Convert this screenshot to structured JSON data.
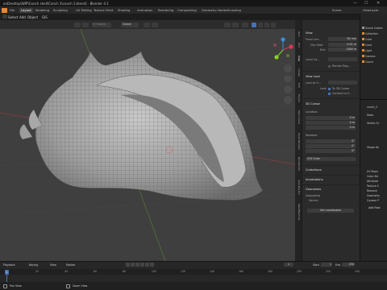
{
  "window": {
    "title": "onDesktop\\WIP\\Conch shell\\Conch 3\\conch 3.blend] - Blender 4.1",
    "minimize": "—",
    "maximize": "☐",
    "close": "✕"
  },
  "workspaces": [
    "Layout",
    "Modeling",
    "Sculpting",
    "UV Editing",
    "Texture Paint",
    "Shading",
    "Animation",
    "Rendering",
    "Compositing",
    "Geometry Nodes",
    "Scripting"
  ],
  "active_workspace": "Layout",
  "top_right": {
    "scene_label": "Scene",
    "layer_label": "ViewLayer"
  },
  "menus": [
    "Select",
    "Add",
    "Object",
    "GIS"
  ],
  "viewport_header": {
    "orientation": "Global",
    "search_placeholder": "Search",
    "options_label": "Options"
  },
  "sidebar_tabs": [
    "Item",
    "Tool",
    "View",
    "Create",
    "Edit",
    "Export",
    "Point Cloud",
    "Quad Remesh",
    "BlenderGIS",
    "Auto-Rig Pro",
    "MeshMachine"
  ],
  "n_panel": {
    "view_section": "View",
    "focal_length_label": "Focal Len...",
    "focal_length_value": "50 mm",
    "clip_start_label": "Clip Start",
    "clip_start_value": "0.01 m",
    "clip_end_label": "End",
    "clip_end_value": "1000 m",
    "local_camera_label": "Local Ca...",
    "render_region_label": "Render Reg...",
    "view_lock_section": "View Lock",
    "lock_to_object_label": "Lock to O...",
    "lock_label": "Lock",
    "to_3d_cursor_label": "To 3D Cursor",
    "camera_to_view_label": "Camera to V...",
    "cursor_section": "3D Cursor",
    "location_label": "Location:",
    "loc_x": "0 m",
    "loc_y": "0 m",
    "loc_z": "0 m",
    "rotation_label": "Rotation:",
    "rot_x": "0°",
    "rot_y": "0°",
    "rot_z": "0°",
    "rotation_mode": "XYZ Euler",
    "collections_section": "Collections",
    "annotations_section": "Annotations",
    "geonames_section": "Geonames",
    "geonames_label": "Geonames",
    "geonames_server_label": "Server:",
    "geonames_server_value": "Get coordinates"
  },
  "right_column": {
    "outliner_items": [
      "Scene Collect",
      "Collection",
      "Cube",
      "Cone",
      "Light",
      "Camera",
      "Conch"
    ],
    "properties_items": [
      "conch_3",
      "Mesh",
      "Vertex Gr",
      "Shape Ke",
      "UV Maps",
      "Color Att",
      "Attribute",
      "Texture S",
      "Remesh",
      "Geometry",
      "Custom P"
    ],
    "add_rest_label": "Add Rest"
  },
  "timeline": {
    "menus": [
      "Playback",
      "Keying",
      "View",
      "Marker"
    ],
    "start_label": "Start",
    "start_value": "1",
    "end_label": "End",
    "end_value": "250",
    "current_frame": "1",
    "ticks": [
      "0",
      "20",
      "40",
      "60",
      "80",
      "100",
      "120",
      "140",
      "160",
      "180",
      "200",
      "220",
      "240"
    ]
  },
  "statusbar": {
    "pan_label": "Pan View",
    "zoom_label": "Zoom View"
  },
  "colors": {
    "viewport_bg": "#3f3f3f",
    "accent_blue": "#4772b3",
    "axis_x": "#e0354f",
    "axis_y": "#8bd31d",
    "axis_z": "#3b8de0",
    "playhead": "#4772b3"
  }
}
